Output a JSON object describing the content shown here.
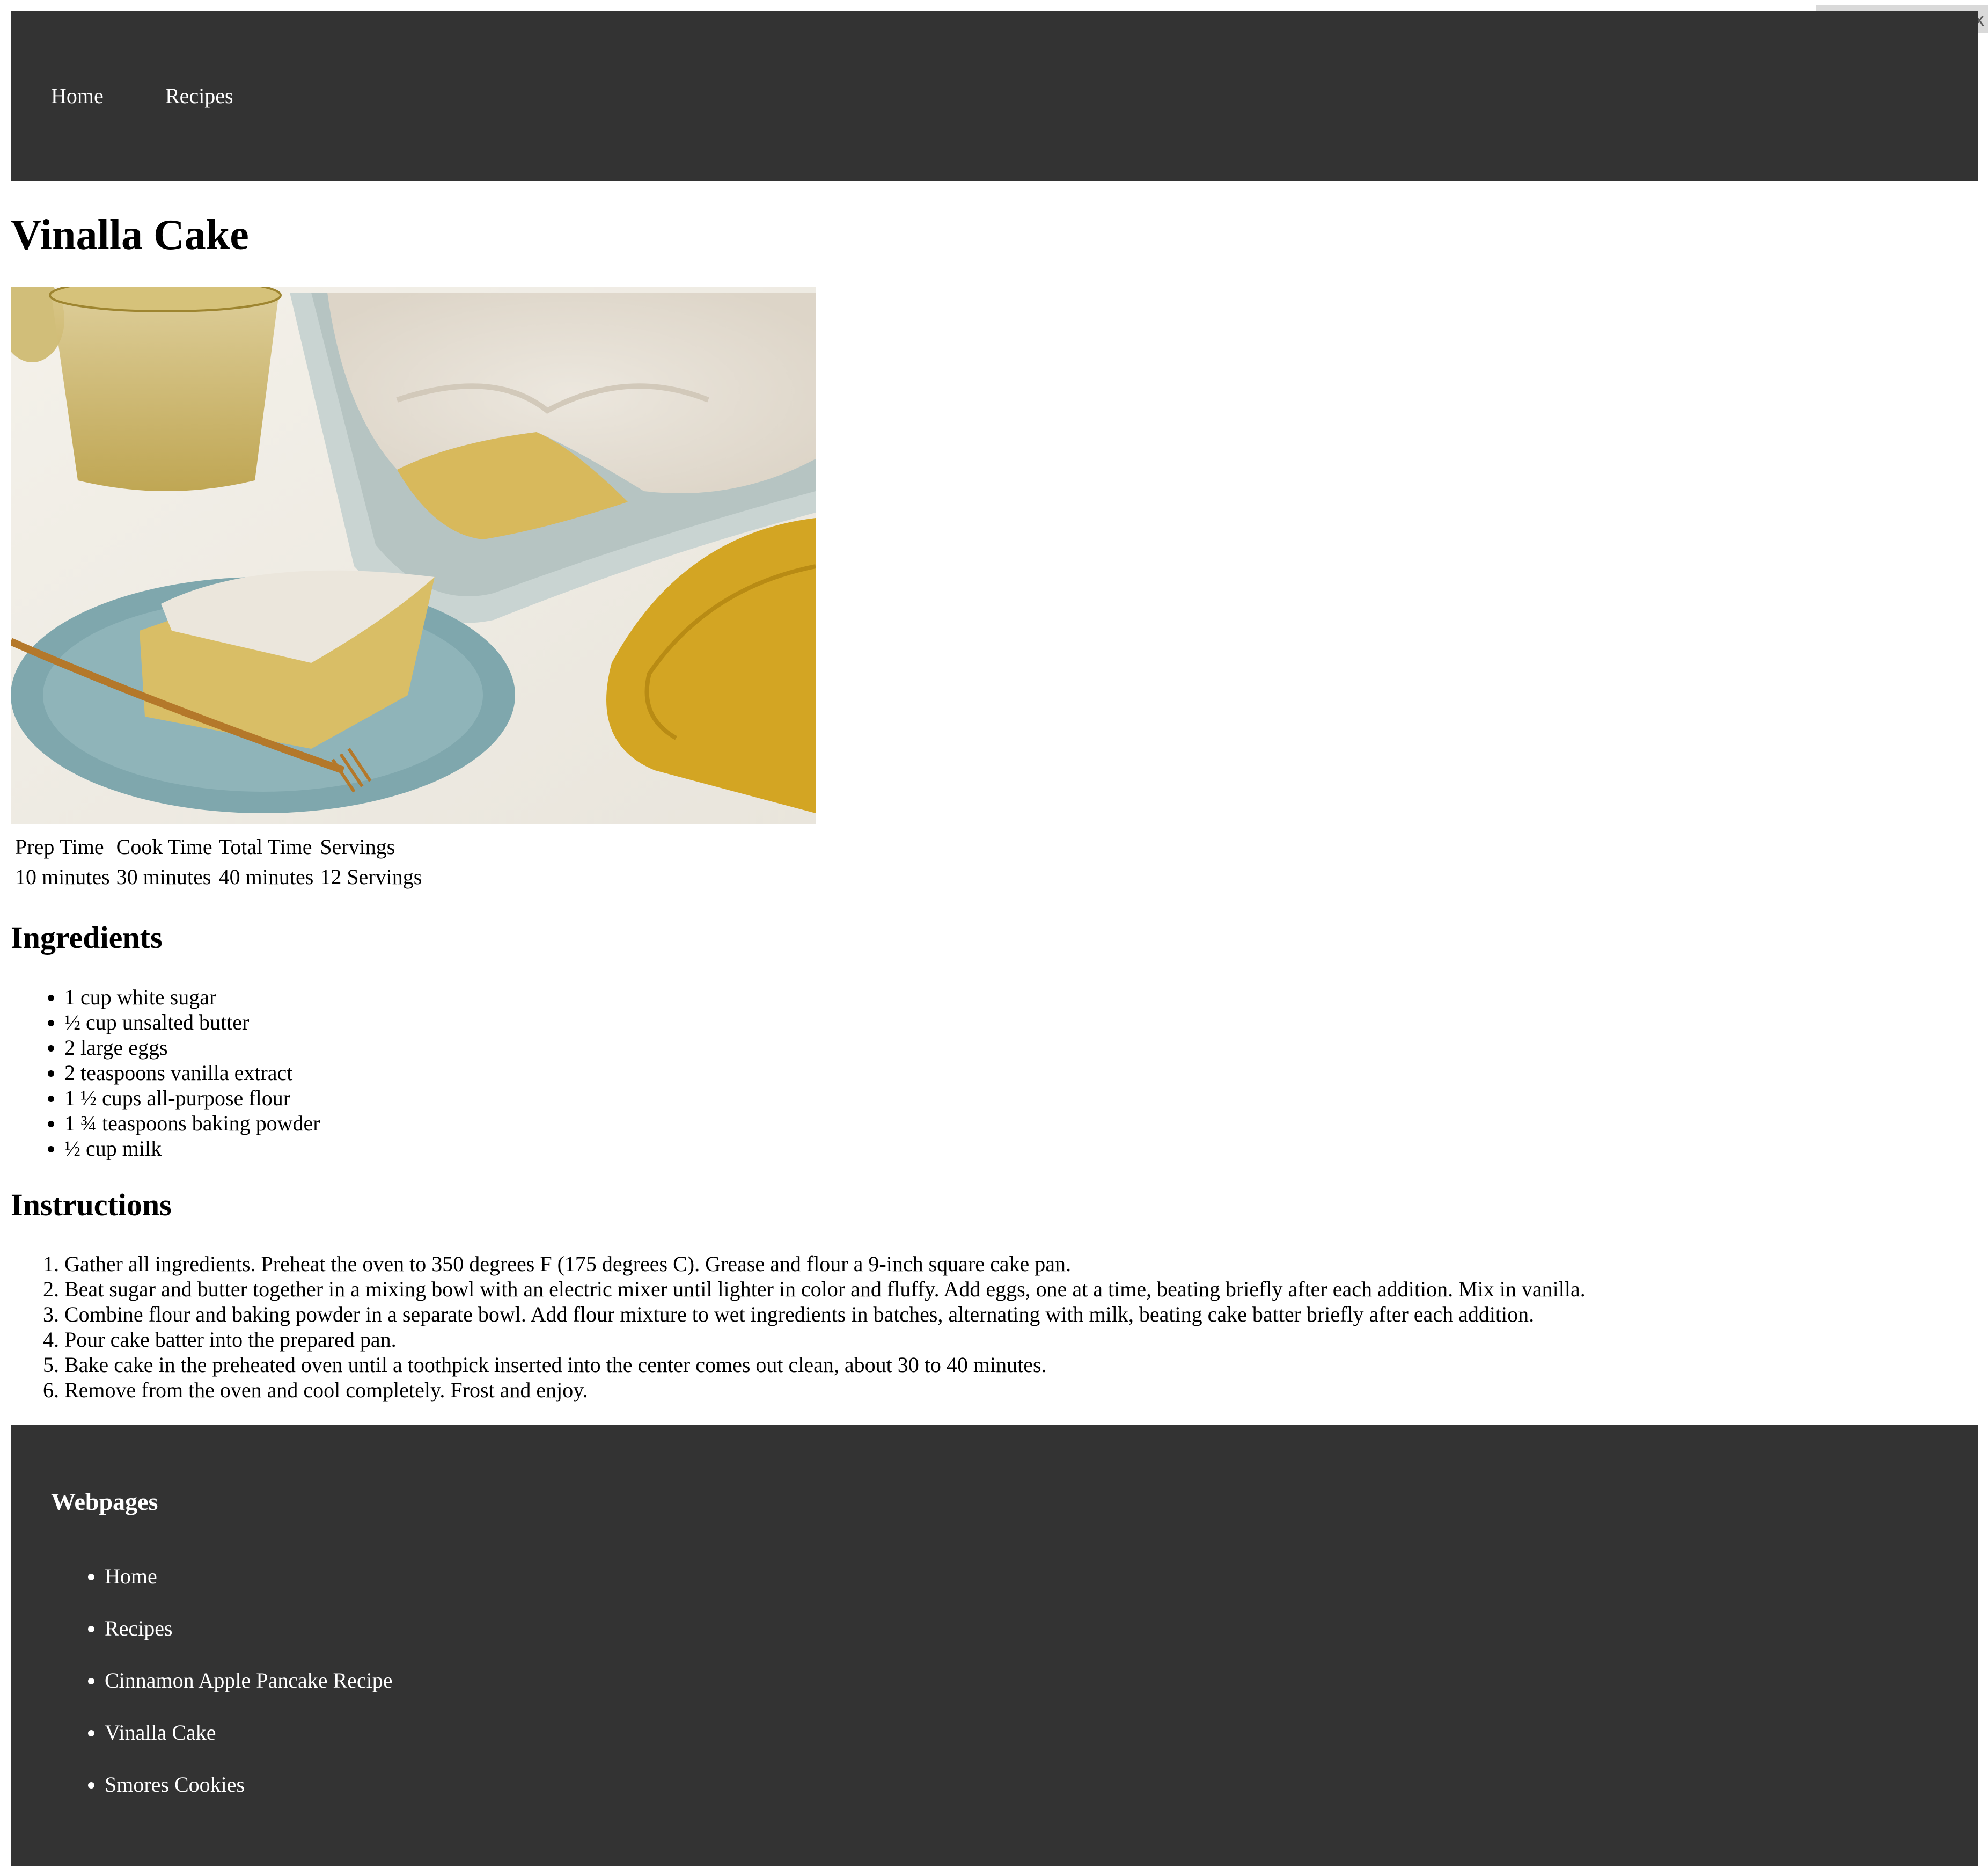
{
  "viewport_badge": "1482px × 695.20px",
  "nav": {
    "home": "Home",
    "recipes": "Recipes"
  },
  "title": "Vinalla Cake",
  "times": {
    "headers": [
      "Prep Time",
      "Cook Time",
      "Total Time",
      "Servings"
    ],
    "values": [
      "10 minutes",
      "30 minutes",
      "40 minutes",
      "12 Servings"
    ]
  },
  "ingredients": {
    "heading": "Ingredients",
    "items": [
      "1 cup white sugar",
      "½ cup unsalted butter",
      "2 large eggs",
      "2 teaspoons vanilla extract",
      "1 ½ cups all-purpose flour",
      "1 ¾ teaspoons baking powder",
      "½ cup milk"
    ]
  },
  "instructions": {
    "heading": "Instructions",
    "steps": [
      "Gather all ingredients. Preheat the oven to 350 degrees F (175 degrees C). Grease and flour a 9-inch square cake pan.",
      "Beat sugar and butter together in a mixing bowl with an electric mixer until lighter in color and fluffy. Add eggs, one at a time, beating briefly after each addition. Mix in vanilla.",
      "Combine flour and baking powder in a separate bowl. Add flour mixture to wet ingredients in batches, alternating with milk, beating cake batter briefly after each addition.",
      "Pour cake batter into the prepared pan.",
      "Bake cake in the preheated oven until a toothpick inserted into the center comes out clean, about 30 to 40 minutes.",
      "Remove from the oven and cool completely. Frost and enjoy."
    ]
  },
  "footer": {
    "heading": "Webpages",
    "links": [
      "Home",
      "Recipes",
      "Cinnamon Apple Pancake Recipe",
      "Vinalla Cake",
      "Smores Cookies"
    ]
  }
}
